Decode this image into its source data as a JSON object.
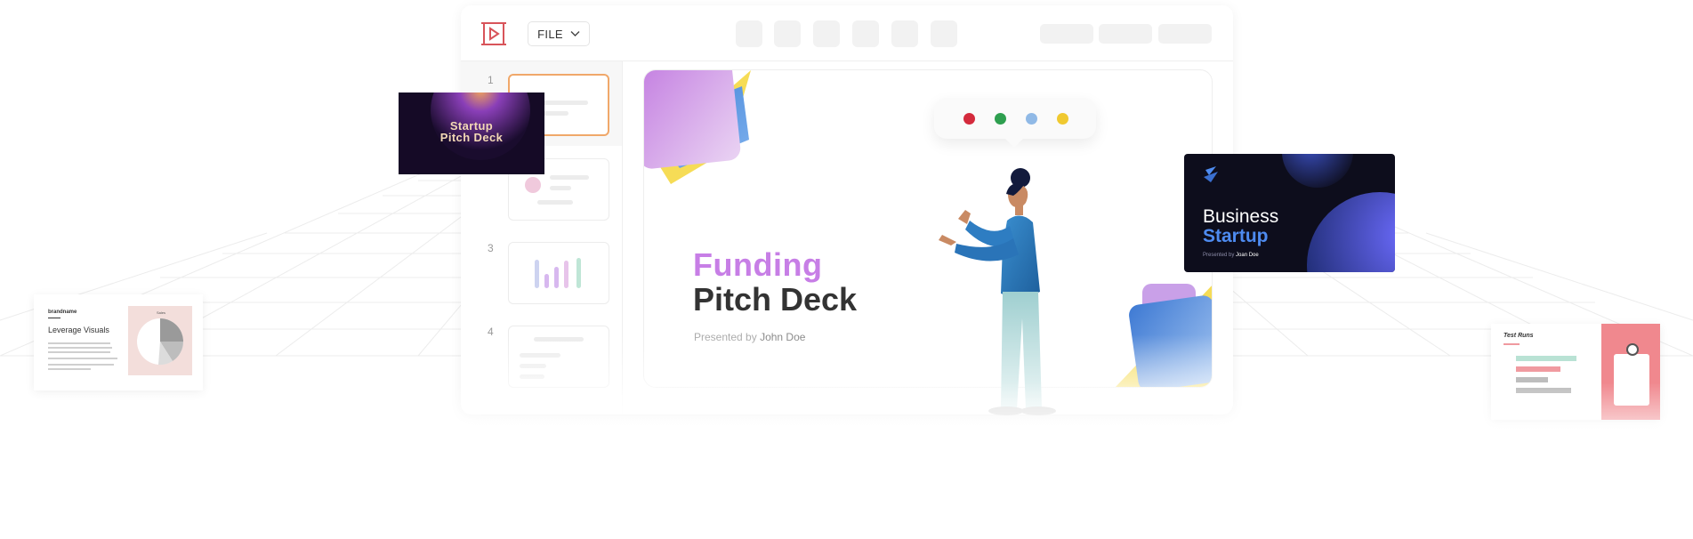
{
  "toolbar": {
    "file_label": "FILE",
    "app_icon": "presentation-play-icon",
    "dropdown_icon": "chevron-down-icon"
  },
  "slides_rail": {
    "slides": [
      {
        "number": "1",
        "active": true
      },
      {
        "number": "",
        "active": false
      },
      {
        "number": "3",
        "active": false
      },
      {
        "number": "4",
        "active": false
      }
    ]
  },
  "main_slide": {
    "title_line1": "Funding",
    "title_line2": "Pitch Deck",
    "presented_prefix": "Presented by",
    "presenter": "John Doe"
  },
  "color_picker": {
    "colors": [
      "#d42a3c",
      "#2e9f4f",
      "#90b9e6",
      "#f0c930"
    ]
  },
  "floating_cards": {
    "startup": {
      "line1": "Startup",
      "line2": "Pitch Deck"
    },
    "business": {
      "line1": "Business",
      "line2": "Startup",
      "presented_prefix": "Presented by",
      "presenter": "Joan Doe"
    },
    "visuals": {
      "brand": "brandname",
      "title": "Leverage Visuals",
      "chart_title": "Sales"
    },
    "test_runs": {
      "title": "Test Runs"
    }
  },
  "colors": {
    "accent_orange": "#f0a86a",
    "funding_purple": "#c77ee6",
    "business_blue": "#4e8bf0"
  }
}
